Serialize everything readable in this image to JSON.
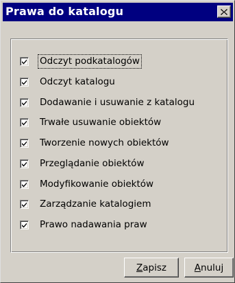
{
  "window": {
    "title": "Prawa do katalogu"
  },
  "permissions": [
    {
      "label": "Odczyt podkatalogów",
      "checked": true
    },
    {
      "label": "Odczyt katalogu",
      "checked": true
    },
    {
      "label": "Dodawanie i usuwanie z katalogu",
      "checked": true
    },
    {
      "label": "Trwałe usuwanie obiektów",
      "checked": true
    },
    {
      "label": "Tworzenie nowych obiektów",
      "checked": true
    },
    {
      "label": "Przeglądanie obiektów",
      "checked": true
    },
    {
      "label": "Modyfikowanie obiektów",
      "checked": true
    },
    {
      "label": "Zarządzanie katalogiem",
      "checked": true
    },
    {
      "label": "Prawo nadawania praw",
      "checked": true
    }
  ],
  "buttons": {
    "save": {
      "mnemonic": "Z",
      "rest": "apisz"
    },
    "cancel": {
      "mnemonic": "A",
      "rest": "nuluj"
    }
  },
  "colors": {
    "titlebar": "#000080",
    "face": "#d4d0c8"
  }
}
